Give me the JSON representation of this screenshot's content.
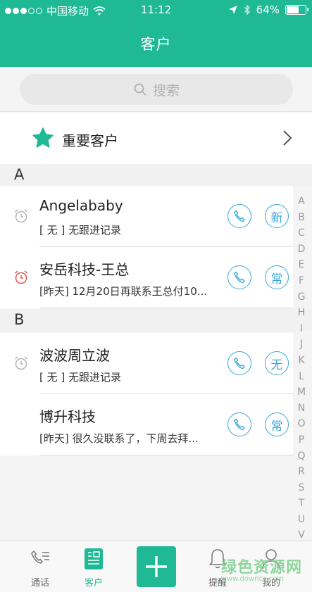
{
  "status_bar": {
    "carrier": "中国移动",
    "time": "11:12",
    "battery_percent": "64%",
    "battery_level": 0.64
  },
  "header": {
    "title": "客户"
  },
  "search": {
    "placeholder": "搜索"
  },
  "important": {
    "label": "重要客户"
  },
  "sections": [
    {
      "letter": "A",
      "rows": [
        {
          "name": "Angelababy",
          "note": "[ 无 ] 无跟进记录",
          "tag": "新",
          "alarm": true,
          "alarm_color": "#b5b5b5"
        },
        {
          "name": "安岳科技-王总",
          "note": "[昨天] 12月20日再联系王总付10...",
          "tag": "常",
          "alarm": true,
          "alarm_color": "#e05a57"
        }
      ]
    },
    {
      "letter": "B",
      "rows": [
        {
          "name": "波波周立波",
          "note": "[ 无 ] 无跟进记录",
          "tag": "无",
          "alarm": true,
          "alarm_color": "#b5b5b5"
        },
        {
          "name": "博升科技",
          "note": "[昨天] 很久没联系了，下周去拜...",
          "tag": "常",
          "alarm": false
        }
      ]
    }
  ],
  "alphabet": [
    "A",
    "B",
    "C",
    "D",
    "E",
    "F",
    "G",
    "H",
    "I",
    "J",
    "K",
    "L",
    "M",
    "N",
    "O",
    "P",
    "Q",
    "R",
    "S",
    "T",
    "U",
    "V"
  ],
  "tabbar": {
    "tabs": [
      {
        "label": "通话",
        "icon": "phone-list-icon"
      },
      {
        "label": "客户",
        "icon": "customer-card-icon",
        "active": true
      },
      {
        "label": "提醒",
        "icon": "bell-icon"
      },
      {
        "label": "我的",
        "icon": "person-icon"
      }
    ]
  },
  "watermark": {
    "text": "绿色资源网",
    "url": "www.downcc.com"
  },
  "colors": {
    "accent": "#1fb996",
    "button_blue": "#3aa7d8",
    "alarm_red": "#e05a57"
  }
}
